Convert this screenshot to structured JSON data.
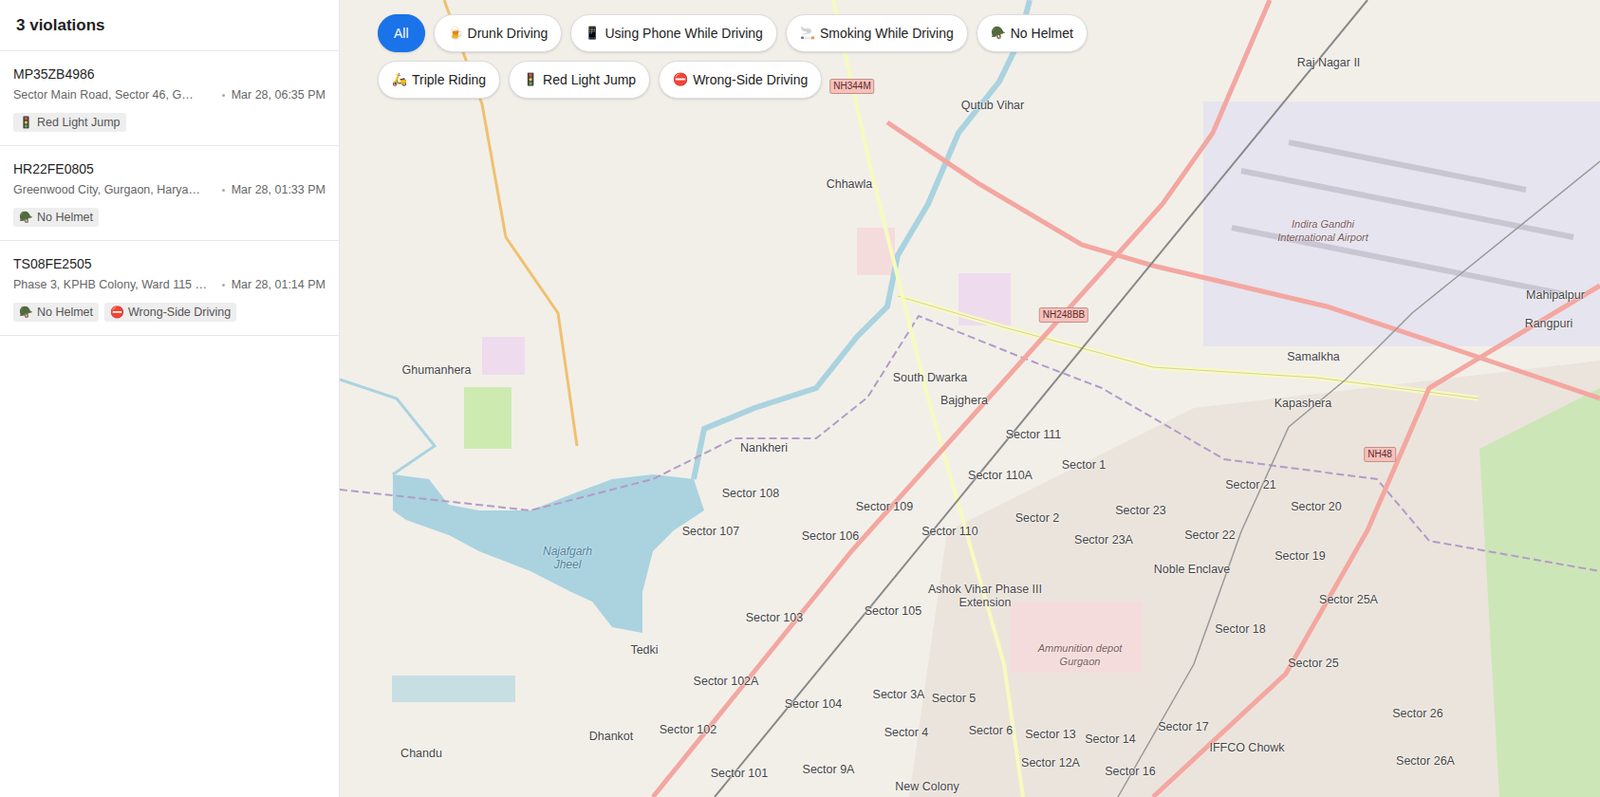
{
  "sidebar": {
    "count": "3 violations",
    "violations": [
      {
        "plate": "MP35ZB4986",
        "address": "Sector Main Road, Sector 46, G…",
        "time": "Mar 28, 06:35 PM",
        "tags": [
          {
            "icon": "🚦",
            "label": "Red Light Jump"
          }
        ]
      },
      {
        "plate": "HR22FE0805",
        "address": "Greenwood City, Gurgaon, Harya…",
        "time": "Mar 28, 01:33 PM",
        "tags": [
          {
            "icon": "🪖",
            "label": "No Helmet"
          }
        ]
      },
      {
        "plate": "TS08FE2505",
        "address": "Phase 3, KPHB Colony, Ward 115 …",
        "time": "Mar 28, 01:14 PM",
        "tags": [
          {
            "icon": "🪖",
            "label": "No Helmet"
          },
          {
            "icon": "⛔",
            "label": "Wrong-Side Driving"
          }
        ]
      }
    ]
  },
  "filters": [
    {
      "icon": "",
      "label": "All",
      "selected": true
    },
    {
      "icon": "🍺",
      "label": "Drunk Driving",
      "selected": false
    },
    {
      "icon": "📱",
      "label": "Using Phone While Driving",
      "selected": false
    },
    {
      "icon": "🚬",
      "label": "Smoking While Driving",
      "selected": false
    },
    {
      "icon": "🪖",
      "label": "No Helmet",
      "selected": false
    },
    {
      "icon": "🛵",
      "label": "Triple Riding",
      "selected": false
    },
    {
      "icon": "🚦",
      "label": "Red Light Jump",
      "selected": false
    },
    {
      "icon": "⛔",
      "label": "Wrong-Side Driving",
      "selected": false
    }
  ],
  "map": {
    "labels": [
      {
        "text": "Chhawla",
        "kind": "place"
      },
      {
        "text": "Qutub Vihar",
        "kind": "place"
      },
      {
        "text": "South Dwarka",
        "kind": "place"
      },
      {
        "text": "Bajghera",
        "kind": "place"
      },
      {
        "text": "Ghumanhera",
        "kind": "place"
      },
      {
        "text": "Nankheri",
        "kind": "place"
      },
      {
        "text": "Najafgarh Jheel",
        "kind": "water"
      },
      {
        "text": "Sector 108",
        "kind": "place"
      },
      {
        "text": "Sector 107",
        "kind": "place"
      },
      {
        "text": "Sector 109",
        "kind": "place"
      },
      {
        "text": "Sector 106",
        "kind": "place"
      },
      {
        "text": "Sector 110",
        "kind": "place"
      },
      {
        "text": "Sector 110A",
        "kind": "place"
      },
      {
        "text": "Sector 111",
        "kind": "place"
      },
      {
        "text": "Sector 103",
        "kind": "place"
      },
      {
        "text": "Sector 105",
        "kind": "place"
      },
      {
        "text": "Ashok Vihar Phase III Extension",
        "kind": "place"
      },
      {
        "text": "Sector 102A",
        "kind": "place"
      },
      {
        "text": "Sector 104",
        "kind": "place"
      },
      {
        "text": "Sector 102",
        "kind": "place"
      },
      {
        "text": "Sector 101",
        "kind": "place"
      },
      {
        "text": "Dhankot",
        "kind": "place"
      },
      {
        "text": "Tedki",
        "kind": "place"
      },
      {
        "text": "Chandu",
        "kind": "place"
      },
      {
        "text": "Kapashera",
        "kind": "place"
      },
      {
        "text": "Samalkha",
        "kind": "place"
      },
      {
        "text": "Mahipalpur",
        "kind": "place"
      },
      {
        "text": "Rangpuri",
        "kind": "place"
      },
      {
        "text": "Raj Nagar II",
        "kind": "place"
      },
      {
        "text": "Sector 2",
        "kind": "place"
      },
      {
        "text": "Sector 23",
        "kind": "place"
      },
      {
        "text": "Sector 23A",
        "kind": "place"
      },
      {
        "text": "Sector 22",
        "kind": "place"
      },
      {
        "text": "Sector 21",
        "kind": "place"
      },
      {
        "text": "Sector 20",
        "kind": "place"
      },
      {
        "text": "Sector 19",
        "kind": "place"
      },
      {
        "text": "Noble Enclave",
        "kind": "place"
      },
      {
        "text": "Sector 18",
        "kind": "place"
      },
      {
        "text": "Sector 25",
        "kind": "place"
      },
      {
        "text": "Sector 25A",
        "kind": "place"
      },
      {
        "text": "Sector 3A",
        "kind": "place"
      },
      {
        "text": "Sector 5",
        "kind": "place"
      },
      {
        "text": "Sector 4",
        "kind": "place"
      },
      {
        "text": "Sector 6",
        "kind": "place"
      },
      {
        "text": "Sector 13",
        "kind": "place"
      },
      {
        "text": "Sector 14",
        "kind": "place"
      },
      {
        "text": "Sector 12A",
        "kind": "place"
      },
      {
        "text": "Sector 17",
        "kind": "place"
      },
      {
        "text": "Sector 16",
        "kind": "place"
      },
      {
        "text": "IFFCO Chowk",
        "kind": "place"
      },
      {
        "text": "Sector 1",
        "kind": "place"
      },
      {
        "text": "Sector 26",
        "kind": "place"
      },
      {
        "text": "Sector 26A",
        "kind": "place"
      },
      {
        "text": "New Colony",
        "kind": "place"
      },
      {
        "text": "Ammunition depot Gurgaon",
        "kind": "area"
      },
      {
        "text": "Sector 9A",
        "kind": "place"
      },
      {
        "text": "Indira Gandhi International Airport",
        "kind": "area"
      },
      {
        "text": "NH344M",
        "kind": "shield"
      },
      {
        "text": "NH248BB",
        "kind": "shield"
      },
      {
        "text": "NH48",
        "kind": "shield"
      }
    ]
  }
}
